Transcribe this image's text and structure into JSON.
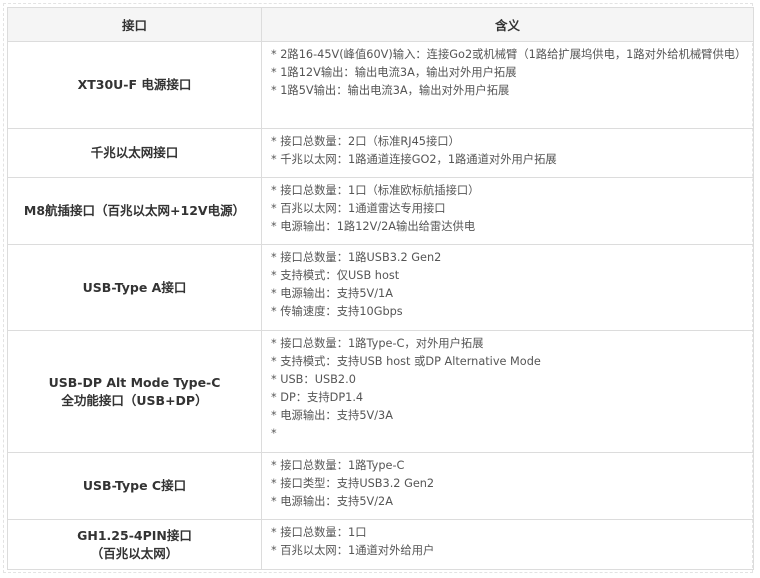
{
  "table": {
    "headers": [
      "接口",
      "含义"
    ],
    "rows": [
      {
        "name": [
          "XT30U-F 电源接口"
        ],
        "lines": [
          "* 2路16-45V(峰值60V)输入：连接Go2或机械臂（1路给扩展坞供电，1路对外给机械臂供电）",
          "* 1路12V输出：输出电流3A，输出对外用户拓展",
          "* 1路5V输出：输出电流3A，输出对外用户拓展"
        ]
      },
      {
        "name": [
          "千兆以太网接口"
        ],
        "lines": [
          "* 接口总数量：2口（标准RJ45接口）",
          "* 千兆以太网：1路通道连接GO2，1路通道对外用户拓展"
        ]
      },
      {
        "name": [
          "M8航插接口（百兆以太网+12V电源）"
        ],
        "lines": [
          "* 接口总数量：1口（标准欧标航插接口）",
          "* 百兆以太网：1通道雷达专用接口",
          "* 电源输出：1路12V/2A输出给雷达供电"
        ]
      },
      {
        "name": [
          "USB-Type A接口"
        ],
        "lines": [
          "* 接口总数量：1路USB3.2 Gen2",
          "* 支持模式：仅USB host",
          "* 电源输出：支持5V/1A",
          "* 传输速度：支持10Gbps"
        ]
      },
      {
        "name": [
          "USB-DP Alt Mode Type-C",
          "全功能接口（USB+DP）"
        ],
        "lines": [
          "* 接口总数量：1路Type-C，对外用户拓展",
          "* 支持模式：支持USB host 或DP Alternative Mode",
          "* USB：USB2.0",
          "* DP：支持DP1.4",
          "* 电源输出：支持5V/3A",
          "*"
        ]
      },
      {
        "name": [
          "USB-Type C接口"
        ],
        "lines": [
          "* 接口总数量：1路Type-C",
          "* 接口类型：支持USB3.2 Gen2",
          "* 电源输出：支持5V/2A"
        ]
      },
      {
        "name": [
          "GH1.25-4PIN接口",
          "（百兆以太网）"
        ],
        "lines": [
          "* 接口总数量：1口",
          "* 百兆以太网：1通道对外给用户"
        ]
      }
    ]
  }
}
